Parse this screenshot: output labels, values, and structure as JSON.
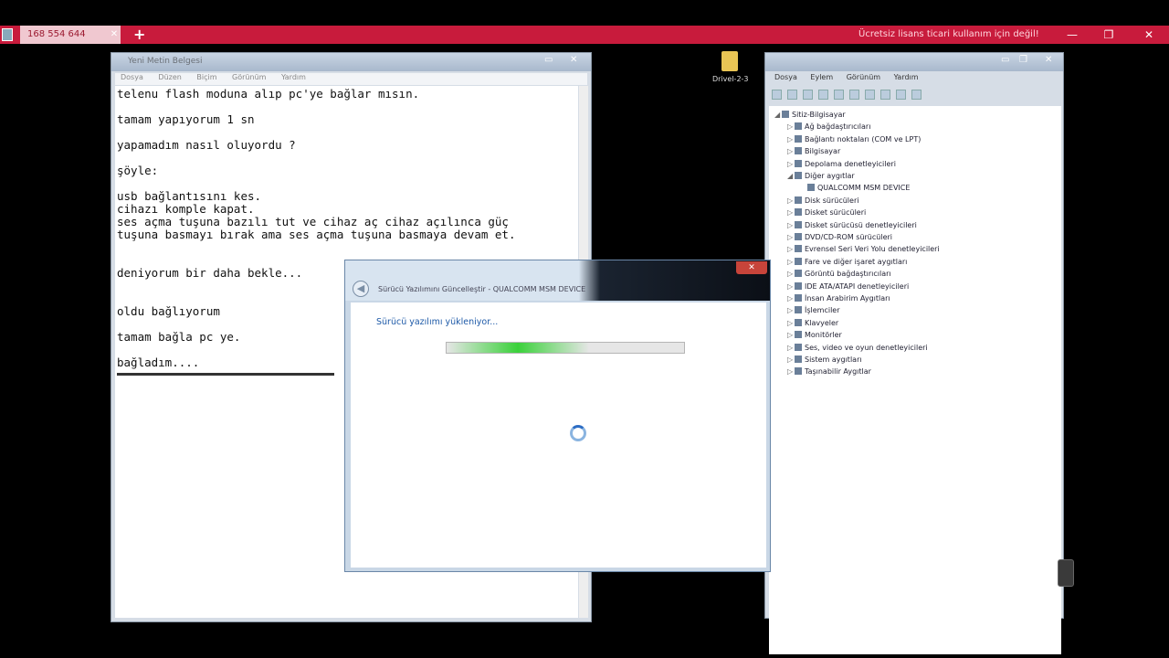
{
  "remote_bar": {
    "tab_id": "168 554 644",
    "banner": "Ücretsiz lisans ticari kullanım için değil!",
    "minimize": "—",
    "restore": "❐",
    "close": "✕",
    "new_tab": "+",
    "tab_close": "✕"
  },
  "notepad": {
    "title": "Yeni Metin Belgesi",
    "menu": [
      "Dosya",
      "Düzen",
      "Biçim",
      "Görünüm",
      "Yardım"
    ],
    "lines": [
      "telenu flash moduna alıp pc'ye bağlar mısın.",
      "",
      "tamam yapıyorum 1 sn",
      "",
      "yapamadım nasıl oluyordu ?",
      "",
      "şöyle:",
      "",
      "usb bağlantısını kes.",
      "cihazı komple kapat.",
      "ses açma tuşuna bazılı tut ve cihaz aç cihaz açılınca güç",
      "tuşuna basmayı bırak ama ses açma tuşuna basmaya devam et.",
      "",
      "",
      "deniyorum bir daha bekle...",
      "",
      "",
      "oldu bağlıyorum",
      "",
      "tamam bağla pc ye.",
      "",
      "bağladım...."
    ]
  },
  "desktop": {
    "folder_label": "Drivel-2-3"
  },
  "device_manager": {
    "menu": [
      "Dosya",
      "Eylem",
      "Görünüm",
      "Yardım"
    ],
    "tree": [
      {
        "label": "Sitiz-Bilgisayar",
        "level": 0,
        "expanded": true
      },
      {
        "label": "Ağ bağdaştırıcıları",
        "level": 1
      },
      {
        "label": "Bağlantı noktaları (COM ve LPT)",
        "level": 1
      },
      {
        "label": "Bilgisayar",
        "level": 1
      },
      {
        "label": "Depolama denetleyicileri",
        "level": 1
      },
      {
        "label": "Diğer aygıtlar",
        "level": 1,
        "expanded": true
      },
      {
        "label": "QUALCOMM MSM DEVICE",
        "level": 2
      },
      {
        "label": "Disk sürücüleri",
        "level": 1
      },
      {
        "label": "Disket sürücüleri",
        "level": 1
      },
      {
        "label": "Disket sürücüsü denetleyicileri",
        "level": 1
      },
      {
        "label": "DVD/CD-ROM sürücüleri",
        "level": 1
      },
      {
        "label": "Evrensel Seri Veri Yolu denetleyicileri",
        "level": 1
      },
      {
        "label": "Fare ve diğer işaret aygıtları",
        "level": 1
      },
      {
        "label": "Görüntü bağdaştırıcıları",
        "level": 1
      },
      {
        "label": "IDE ATA/ATAPI denetleyicileri",
        "level": 1
      },
      {
        "label": "İnsan Arabirim Aygıtları",
        "level": 1
      },
      {
        "label": "İşlemciler",
        "level": 1
      },
      {
        "label": "Klavyeler",
        "level": 1
      },
      {
        "label": "Monitörler",
        "level": 1
      },
      {
        "label": "Ses, video ve oyun denetleyicileri",
        "level": 1
      },
      {
        "label": "Sistem aygıtları",
        "level": 1
      },
      {
        "label": "Taşınabilir Aygıtlar",
        "level": 1
      }
    ]
  },
  "dialog": {
    "title": "Sürücü Yazılımını Güncelleştir - QUALCOMM MSM DEVICE",
    "status": "Sürücü yazılımı yükleniyor...",
    "close_label": "✕",
    "back_label": "◀"
  }
}
